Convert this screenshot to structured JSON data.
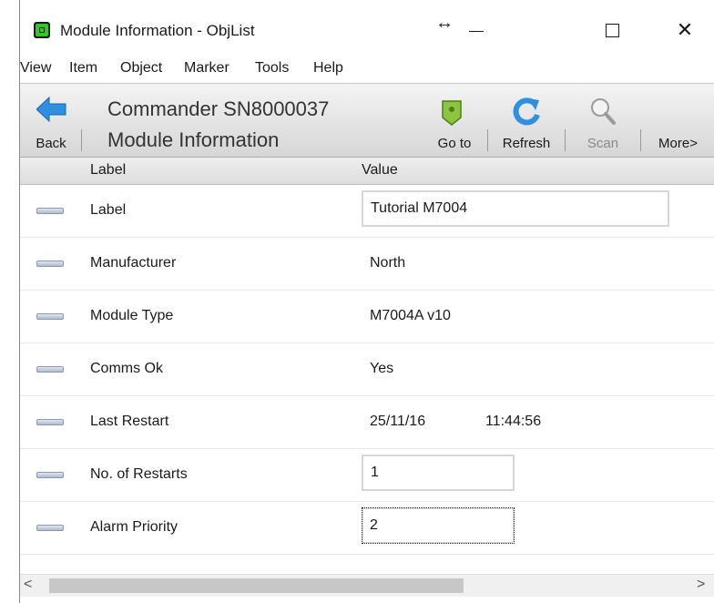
{
  "window": {
    "title": "Module Information - ObjList",
    "resize_glyph": "↔",
    "minimize_glyph": "",
    "maximize_glyph": "",
    "close_glyph": "✕"
  },
  "menu": {
    "items": [
      "View",
      "Item",
      "Object",
      "Marker",
      "Tools",
      "Help"
    ]
  },
  "toolbar": {
    "back_label": "Back",
    "heading_line1": "Commander SN8000037",
    "heading_line2": "Module Information",
    "goto_label": "Go to",
    "refresh_label": "Refresh",
    "scan_label": "Scan",
    "more_label": "More>"
  },
  "columns": {
    "label": "Label",
    "value": "Value"
  },
  "rows": [
    {
      "label": "Label",
      "value": "Tutorial M7004",
      "editable": true
    },
    {
      "label": "Manufacturer",
      "value": "North"
    },
    {
      "label": "Module Type",
      "value": "M7004A v10"
    },
    {
      "label": "Comms Ok",
      "value": "Yes"
    },
    {
      "label": "Last Restart",
      "value": "25/11/16",
      "time": "11:44:56"
    },
    {
      "label": "No. of Restarts",
      "value": "1",
      "editable": true
    },
    {
      "label": "Alarm Priority",
      "value": "2",
      "editable": true,
      "focused": true
    }
  ],
  "scrollbar": {
    "left_arrow": "<",
    "right_arrow": ">"
  },
  "colors": {
    "accent_blue": "#2f8fe0",
    "marker_green": "#8cc63f"
  }
}
